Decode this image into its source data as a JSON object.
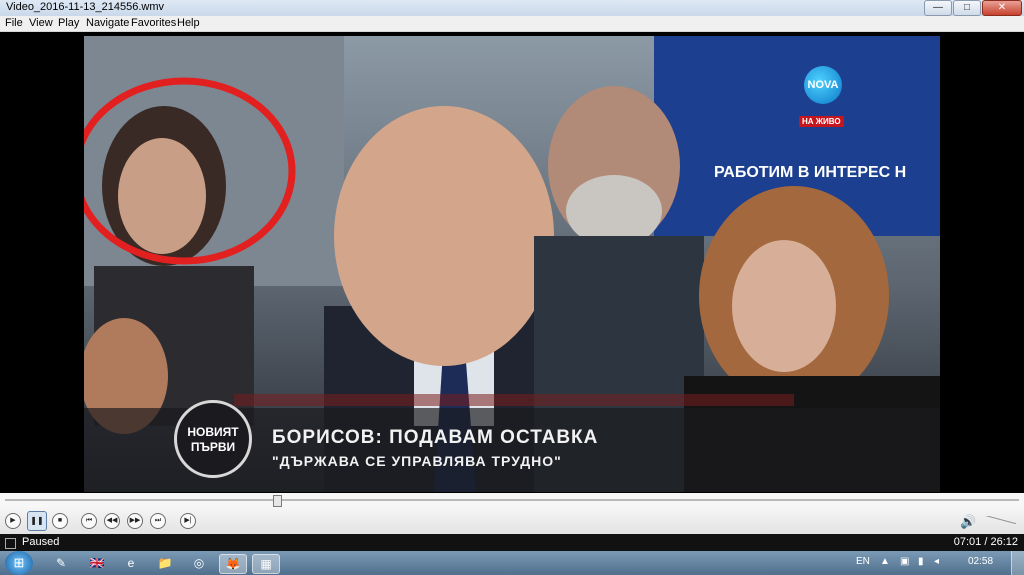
{
  "window": {
    "title": "Video_2016-11-13_214556.wmv",
    "minimize_glyph": "—",
    "maximize_glyph": "□",
    "close_glyph": "✕"
  },
  "menu": [
    "File",
    "View",
    "Play",
    "Navigate",
    "Favorites",
    "Help"
  ],
  "video": {
    "channel_logo": "NOVA",
    "live_badge": "НА ЖИВО",
    "background_slogan": "РАБОТИМ В ИНТЕРЕС Н",
    "show_logo": [
      "НОВИЯТ",
      "ПЪРВИ"
    ],
    "headline": "БОРИСОВ: ПОДАВАМ ОСТАВКА",
    "quote": "\"ДЪРЖАВА СЕ УПРАВЛЯВА ТРУДНО\""
  },
  "seek": {
    "position_fraction": 0.268
  },
  "controls": {
    "play": "▶",
    "pause": "❚❚",
    "stop": "■",
    "skip_back": "⏮",
    "rewind": "◀◀",
    "fast_forward": "▶▶",
    "skip_forward": "⏭",
    "frame_step": "▶|",
    "volume_icon": "🔊"
  },
  "status": {
    "text": "Paused",
    "time": "07:01 / 26:12"
  },
  "taskbar": {
    "start_glyph": "⊞",
    "apps": [
      {
        "name": "paint-icon",
        "glyph": "✎"
      },
      {
        "name": "language-flag-icon",
        "glyph": "🇬🇧"
      },
      {
        "name": "internet-explorer-icon",
        "glyph": "e"
      },
      {
        "name": "explorer-folder-icon",
        "glyph": "📁"
      },
      {
        "name": "media-icon",
        "glyph": "◎"
      },
      {
        "name": "firefox-icon",
        "glyph": "🦊"
      },
      {
        "name": "video-player-icon",
        "glyph": "▦"
      }
    ],
    "language": "EN",
    "clock": "02:58"
  },
  "colors": {
    "annotation_circle": "#e32020",
    "accent_blue": "#1b5fa0"
  }
}
